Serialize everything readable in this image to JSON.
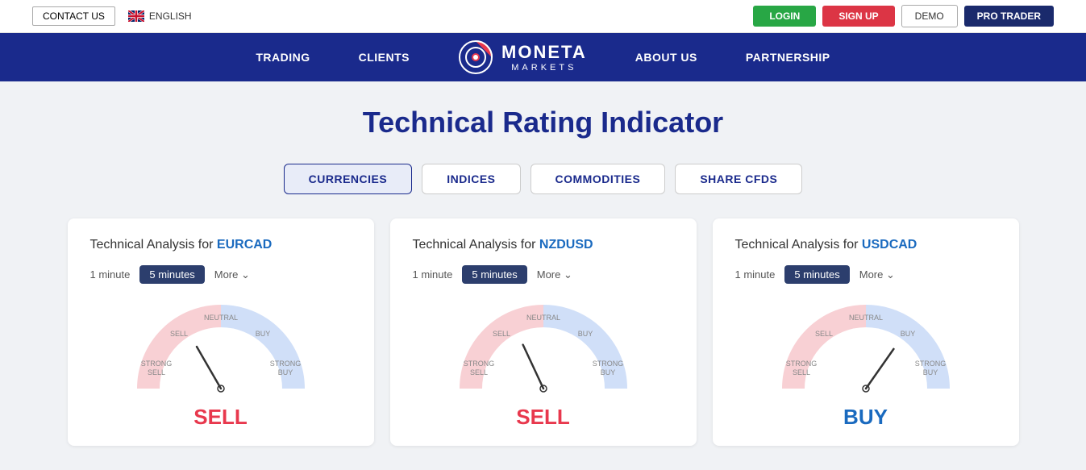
{
  "topbar": {
    "contact_label": "CONTACT US",
    "lang_label": "ENGLISH",
    "login_label": "LOGIN",
    "signup_label": "SIGN UP",
    "demo_label": "DEMO",
    "pro_label": "PRO TRADER"
  },
  "navbar": {
    "trading_label": "TRADING",
    "clients_label": "CLIENTS",
    "about_label": "ABOUT US",
    "partnership_label": "PARTNERSHIP",
    "brand_name": "MONETA",
    "brand_sub": "MARKETS"
  },
  "page": {
    "title": "Technical Rating Indicator"
  },
  "tabs": [
    {
      "label": "CURRENCIES",
      "active": true
    },
    {
      "label": "INDICES",
      "active": false
    },
    {
      "label": "COMMODITIES",
      "active": false
    },
    {
      "label": "SHARE CFDS",
      "active": false
    }
  ],
  "cards": [
    {
      "title_prefix": "Technical Analysis for ",
      "pair": "EURCAD",
      "time_1m": "1 minute",
      "time_5m": "5 minutes",
      "more_label": "More",
      "result": "SELL",
      "result_type": "sell",
      "needle_angle": -30
    },
    {
      "title_prefix": "Technical Analysis for ",
      "pair": "NZDUSD",
      "time_1m": "1 minute",
      "time_5m": "5 minutes",
      "more_label": "More",
      "result": "SELL",
      "result_type": "sell",
      "needle_angle": -25
    },
    {
      "title_prefix": "Technical Analysis for ",
      "pair": "USDCAD",
      "time_1m": "1 minute",
      "time_5m": "5 minutes",
      "more_label": "More",
      "result": "BUY",
      "result_type": "buy",
      "needle_angle": 35
    }
  ]
}
